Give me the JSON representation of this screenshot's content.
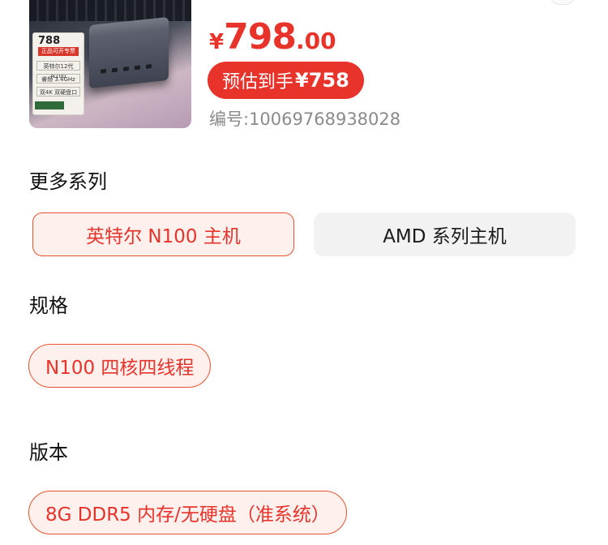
{
  "product": {
    "thumbnail": {
      "price": "788",
      "tag": "正品可开专票",
      "line1": "英特尔12代N100",
      "line2": "睿频 3.4GHz",
      "line3": "双4K 双硬盘口"
    },
    "currency": "¥",
    "price_int": "798",
    "price_dec": ".00",
    "estimate_prefix": "预估到手",
    "estimate_amount": "¥758",
    "sku": "编号:10069768938028"
  },
  "sections": {
    "series": {
      "title": "更多系列",
      "options": [
        {
          "label": "英特尔 N100 主机",
          "selected": true
        },
        {
          "label": "AMD 系列主机",
          "selected": false
        }
      ]
    },
    "spec": {
      "title": "规格",
      "options": [
        {
          "label": "N100 四核四线程",
          "selected": true
        }
      ]
    },
    "version": {
      "title": "版本",
      "options": [
        {
          "label": "8G DDR5 内存/无硬盘（准系统）",
          "selected": true
        }
      ]
    }
  },
  "colors": {
    "accent": "#e8332b",
    "selected_bg": "#fdf0ed",
    "unselected_bg": "#f2f2f2"
  }
}
